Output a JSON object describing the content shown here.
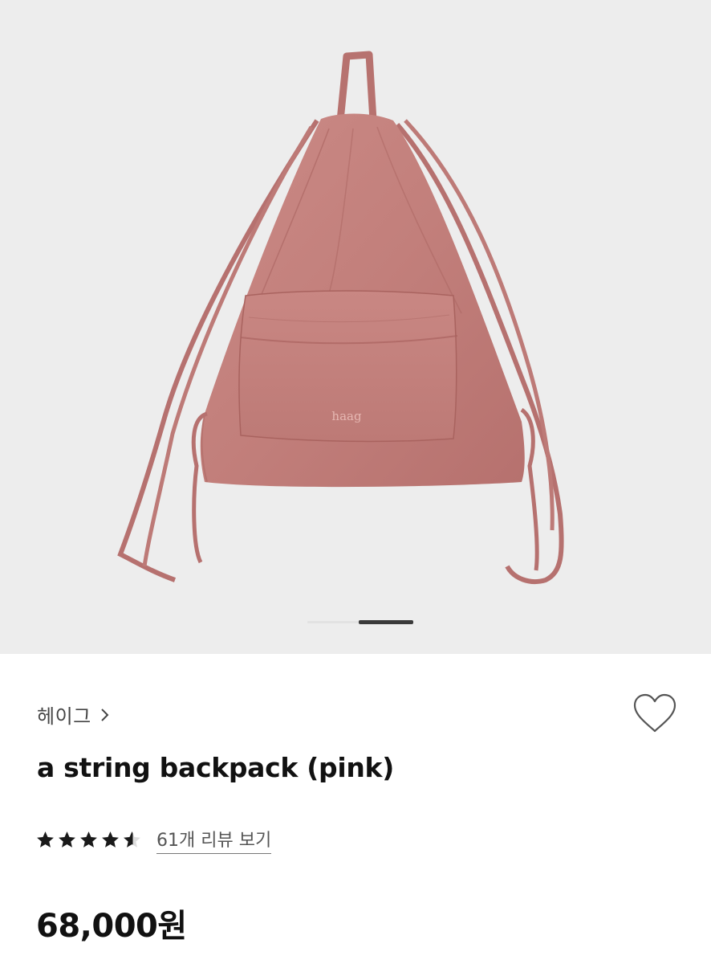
{
  "gallery": {
    "image_alt": "pink drawstring backpack",
    "logo_text": "haag",
    "slide_count": 2,
    "active_slide": 2
  },
  "product": {
    "brand": "헤이그",
    "title": "a string backpack (pink)",
    "rating": 4.5,
    "review_link": "61개 리뷰 보기",
    "price": "68,000원"
  },
  "icons": {
    "brand_chevron": "chevron-right-icon",
    "like": "heart-outline-icon",
    "rating": "star-icon"
  },
  "colors": {
    "gallery_bg": "#ededed",
    "bag": "#c4827f",
    "text_primary": "#111111",
    "text_secondary": "#555555",
    "star": "#1a1a1a"
  }
}
